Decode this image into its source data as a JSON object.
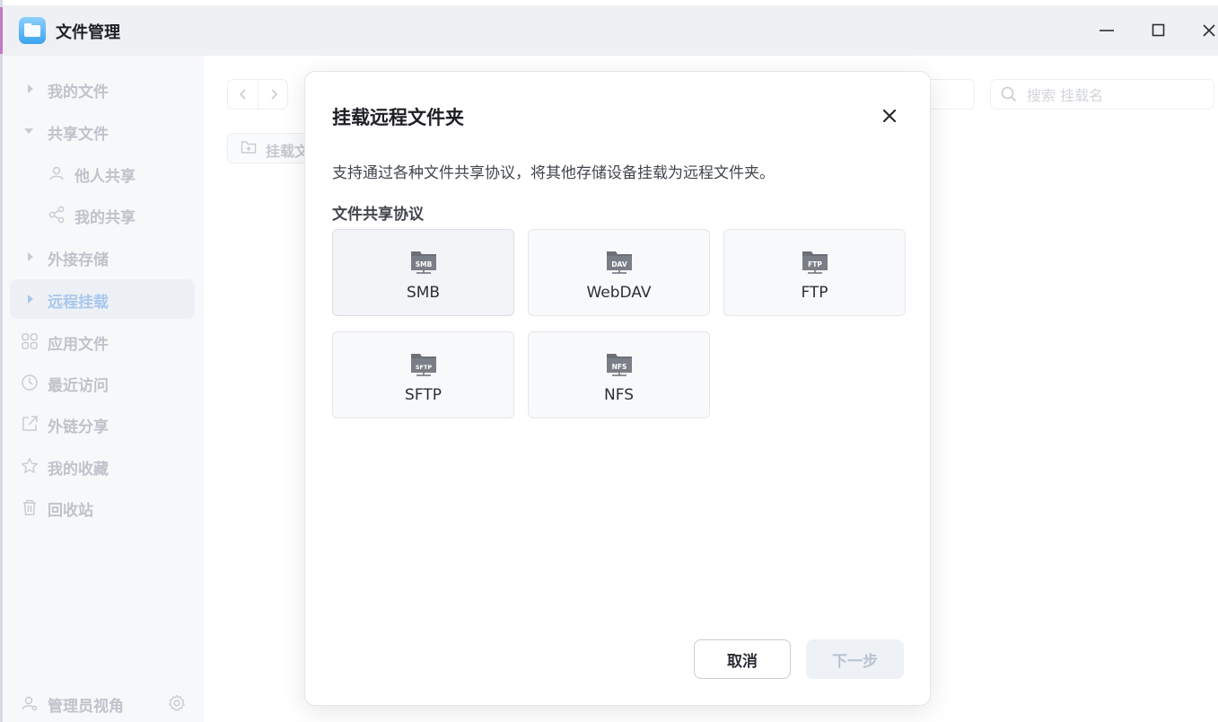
{
  "window": {
    "title": "文件管理"
  },
  "sidebar": {
    "items": [
      {
        "label": "我的文件",
        "kind": "expand"
      },
      {
        "label": "共享文件",
        "kind": "collapse"
      },
      {
        "label": "他人共享",
        "kind": "sub"
      },
      {
        "label": "我的共享",
        "kind": "sub"
      },
      {
        "label": "外接存储",
        "kind": "expand"
      },
      {
        "label": "远程挂载",
        "kind": "expand",
        "active": true
      },
      {
        "label": "应用文件",
        "kind": "icon"
      },
      {
        "label": "最近访问",
        "kind": "icon"
      },
      {
        "label": "外链分享",
        "kind": "icon"
      },
      {
        "label": "我的收藏",
        "kind": "icon"
      },
      {
        "label": "回收站",
        "kind": "icon"
      }
    ],
    "footer_label": "管理员视角"
  },
  "main": {
    "mount_button_label": "挂载文",
    "search_placeholder": "搜索 挂载名"
  },
  "modal": {
    "title": "挂载远程文件夹",
    "description": "支持通过各种文件共享协议，将其他存储设备挂载为远程文件夹。",
    "section_label": "文件共享协议",
    "protocols": [
      {
        "label": "SMB",
        "icon_text": "SMB"
      },
      {
        "label": "WebDAV",
        "icon_text": "DAV"
      },
      {
        "label": "FTP",
        "icon_text": "FTP"
      },
      {
        "label": "SFTP",
        "icon_text": "SFTP"
      },
      {
        "label": "NFS",
        "icon_text": "NFS"
      }
    ],
    "cancel_label": "取消",
    "next_label": "下一步"
  },
  "colors": {
    "accent": "#3ba3ef",
    "active_nav_text": "#a9c7ee"
  }
}
